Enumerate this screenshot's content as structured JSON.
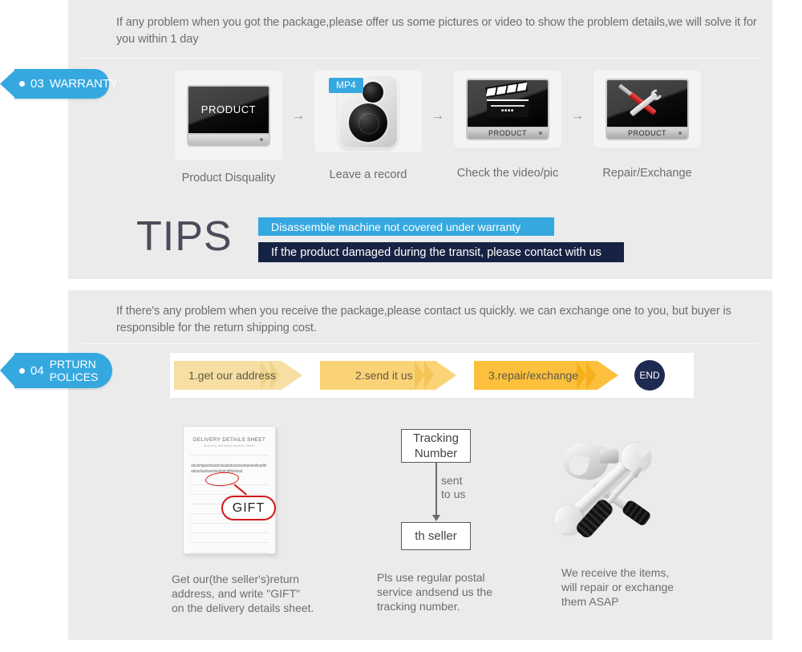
{
  "theme": {
    "panel_bg": "#ebebeb",
    "page_bg": "#ffffff",
    "accent_blue": "#35a8e0",
    "navy": "#172344",
    "end_navy": "#1e2a52",
    "yellow_1": "#f7dfa3",
    "yellow_2": "#fbd377",
    "yellow_3": "#fcc03d",
    "red": "#d41818",
    "body_text": "#6d6d6d"
  },
  "warranty": {
    "tag": {
      "number": "03",
      "label": "WARRANTY"
    },
    "intro": "If any problem when you got the package,please offer us some pictures or video to show the problem details,we will solve it for you within 1 day",
    "steps": [
      {
        "caption": "Product Disquality",
        "icon": "monitor-product-icon",
        "screen_label": "PRODUCT"
      },
      {
        "caption": "Leave a record",
        "icon": "mp4-recorder-icon",
        "badge": "MP4"
      },
      {
        "caption": "Check the video/pic",
        "icon": "clapperboard-monitor-icon",
        "base_label": "PRODUCT"
      },
      {
        "caption": "Repair/Exchange",
        "icon": "tools-monitor-icon",
        "base_label": "PRODUCT"
      }
    ],
    "arrow_glyph": "→",
    "tips": {
      "heading": "TIPS",
      "lines": [
        "Disassemble machine not covered under warranty",
        "If the product damaged during the transit, please contact with us"
      ]
    }
  },
  "returns": {
    "tag": {
      "number": "04",
      "label_line1": "PRTURN",
      "label_line2": "POLICES"
    },
    "intro": "If  there's any problem when you receive the package,please contact us quickly. we can exchange one to you, but buyer is responsible for the return shipping cost.",
    "ribbon": {
      "steps": [
        "1.get our address",
        "2.send it us",
        "3.repair/exchange"
      ],
      "end_label": "END"
    },
    "columns": [
      {
        "caption": "Get our(the seller's)return\naddress, and write \"GIFT\"\non the delivery details sheet.",
        "sheet": {
          "title": "DELIVERY DETAILS SHEET",
          "subtitle": "delivery        delivery details sheet",
          "scribble": "abcdefgasddsadcdsadsdsadsasdasdsadsadfsadasdsadsasdasdsdcgfrtjsdsad",
          "callout": "GIFT"
        }
      },
      {
        "caption": "Pls use regular postal\nservice andsend us the\n tracking number.",
        "flow": {
          "from": "Tracking\nNumber",
          "edge_label": "sent\nto us",
          "to": "th seller"
        }
      },
      {
        "caption": "We receive the items,\nwill repair or exchange\n them ASAP",
        "icon": "hammer-wrench-screwdriver-icon"
      }
    ]
  }
}
